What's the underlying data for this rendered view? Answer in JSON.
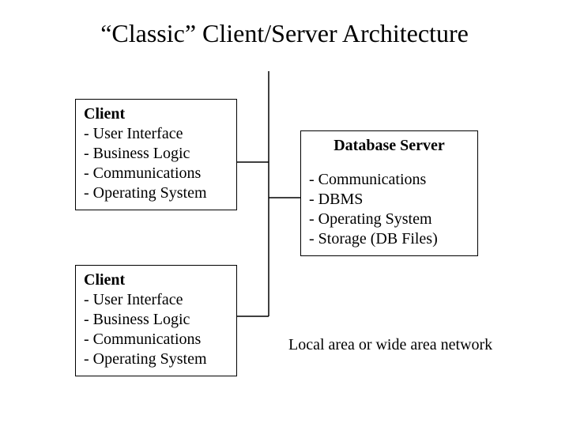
{
  "title": "“Classic” Client/Server Architecture",
  "client1": {
    "header": "Client",
    "l1": "- User Interface",
    "l2": "- Business Logic",
    "l3": "- Communications",
    "l4": "- Operating System"
  },
  "client2": {
    "header": "Client",
    "l1": "- User Interface",
    "l2": "- Business Logic",
    "l3": "- Communications",
    "l4": "- Operating System"
  },
  "server": {
    "header": "Database Server",
    "l1": "- Communications",
    "l2": "- DBMS",
    "l3": "- Operating System",
    "l4": "- Storage (DB Files)"
  },
  "caption": "Local area or wide area network"
}
